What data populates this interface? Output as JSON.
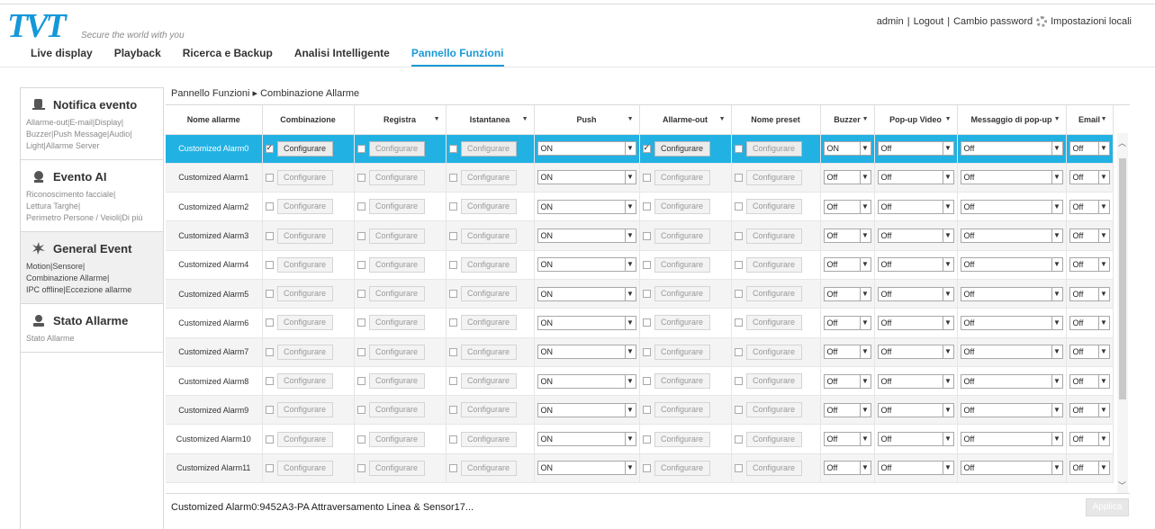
{
  "brand": {
    "logo": "TVT",
    "tagline": "Secure the world with you",
    "color": "#1598d8"
  },
  "user_bar": {
    "user": "admin",
    "sep1": "|",
    "logout": "Logout",
    "sep2": "|",
    "change_password": "Cambio password",
    "local_settings": "Impostazioni locali"
  },
  "nav": {
    "tabs": [
      {
        "label": "Live display"
      },
      {
        "label": "Playback"
      },
      {
        "label": "Ricerca e Backup"
      },
      {
        "label": "Analisi Intelligente"
      },
      {
        "label": "Pannello Funzioni",
        "active": true
      }
    ]
  },
  "sidebar": {
    "sections": [
      {
        "title": "Notifica evento",
        "icon": "bell-icon",
        "links": [
          "Allarme-out|E-mail|Display|",
          "Buzzer|Push Message|Audio|",
          "Light|Allarme Server"
        ]
      },
      {
        "title": "Evento AI",
        "icon": "face-icon",
        "links": [
          "Riconoscimento facciale|",
          "Lettura Targhe|",
          "Perimetro Persone / Veioli|Di più"
        ]
      },
      {
        "title": "General Event",
        "icon": "motion-icon",
        "active": true,
        "links": [
          "Motion|Sensore|",
          "Combinazione Allarme|",
          "IPC offline|Eccezione allarme"
        ]
      },
      {
        "title": "Stato Allarme",
        "icon": "status-icon",
        "links": [
          "Stato Allarme"
        ]
      }
    ]
  },
  "breadcrumb": {
    "root": "Pannello Funzioni",
    "arrow": "▸",
    "current": "Combinazione Allarme"
  },
  "table": {
    "headers": [
      "Nome allarme",
      "Combinazione",
      "Registra",
      "Istantanea",
      "Push",
      "Allarme-out",
      "Nome preset",
      "Buzzer",
      "Pop-up Video",
      "Messaggio di pop-up",
      "Email"
    ],
    "header_caret": "▼",
    "configure_label": "Configurare",
    "rows": [
      {
        "name": "Customized Alarm0",
        "combo_checked": true,
        "alarm_out_checked": true,
        "push": "ON",
        "buzzer": "ON",
        "popup_video": "Off",
        "popup_msg": "Off",
        "email": "Off"
      },
      {
        "name": "Customized Alarm1",
        "push": "ON",
        "buzzer": "Off",
        "popup_video": "Off",
        "popup_msg": "Off",
        "email": "Off"
      },
      {
        "name": "Customized Alarm2",
        "push": "ON",
        "buzzer": "Off",
        "popup_video": "Off",
        "popup_msg": "Off",
        "email": "Off"
      },
      {
        "name": "Customized Alarm3",
        "push": "ON",
        "buzzer": "Off",
        "popup_video": "Off",
        "popup_msg": "Off",
        "email": "Off"
      },
      {
        "name": "Customized Alarm4",
        "push": "ON",
        "buzzer": "Off",
        "popup_video": "Off",
        "popup_msg": "Off",
        "email": "Off"
      },
      {
        "name": "Customized Alarm5",
        "push": "ON",
        "buzzer": "Off",
        "popup_video": "Off",
        "popup_msg": "Off",
        "email": "Off"
      },
      {
        "name": "Customized Alarm6",
        "push": "ON",
        "buzzer": "Off",
        "popup_video": "Off",
        "popup_msg": "Off",
        "email": "Off"
      },
      {
        "name": "Customized Alarm7",
        "push": "ON",
        "buzzer": "Off",
        "popup_video": "Off",
        "popup_msg": "Off",
        "email": "Off"
      },
      {
        "name": "Customized Alarm8",
        "push": "ON",
        "buzzer": "Off",
        "popup_video": "Off",
        "popup_msg": "Off",
        "email": "Off"
      },
      {
        "name": "Customized Alarm9",
        "push": "ON",
        "buzzer": "Off",
        "popup_video": "Off",
        "popup_msg": "Off",
        "email": "Off"
      },
      {
        "name": "Customized Alarm10",
        "push": "ON",
        "buzzer": "Off",
        "popup_video": "Off",
        "popup_msg": "Off",
        "email": "Off"
      },
      {
        "name": "Customized Alarm11",
        "push": "ON",
        "buzzer": "Off",
        "popup_video": "Off",
        "popup_msg": "Off",
        "email": "Off"
      }
    ]
  },
  "status_text": "Customized Alarm0:9452A3-PA Attraversamento Linea & Sensor17...",
  "apply_label": "Applica",
  "colors": {
    "accent": "#1a9ad6",
    "selected_row": "#22b1e3"
  }
}
